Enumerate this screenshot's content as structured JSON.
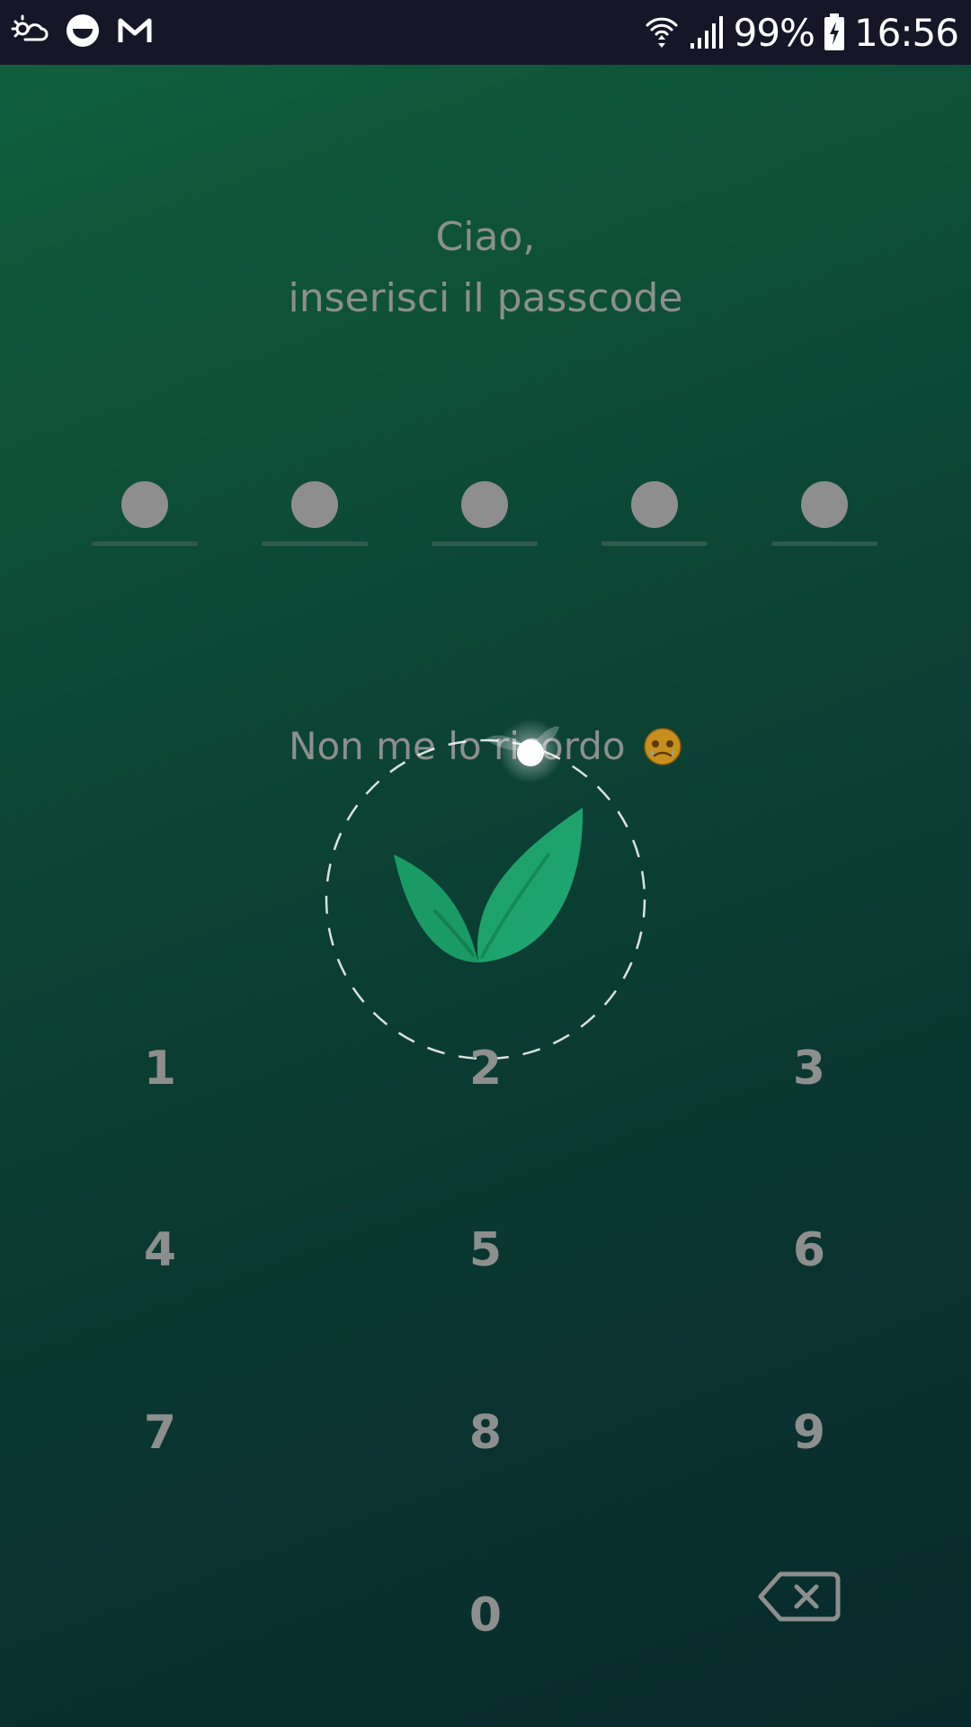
{
  "status_bar": {
    "icons_left": [
      "weather-icon",
      "ubuntu-icon",
      "gmail-icon"
    ],
    "icons_right": [
      "wifi-icon",
      "signal-icon",
      "battery-charging-icon"
    ],
    "battery": "99%",
    "time": "16:56"
  },
  "greeting": {
    "line1": "Ciao,",
    "line2": "inserisci il passcode"
  },
  "passcode": {
    "length": 5,
    "filled": 5
  },
  "forgot": {
    "label": "Non me lo ricordo",
    "emoji_icon": "crying-face-emoji-icon"
  },
  "keypad": {
    "keys": [
      "1",
      "2",
      "3",
      "4",
      "5",
      "6",
      "7",
      "8",
      "9",
      "0"
    ],
    "backspace_icon": "backspace-icon"
  },
  "loader": {
    "icon": "leaf-icon"
  },
  "colors": {
    "background_top": "#10603d",
    "background_bottom": "#082a2c",
    "text_muted": "#8c8f8e",
    "leaf": "#1fa06a",
    "status_bar": "#171629"
  }
}
